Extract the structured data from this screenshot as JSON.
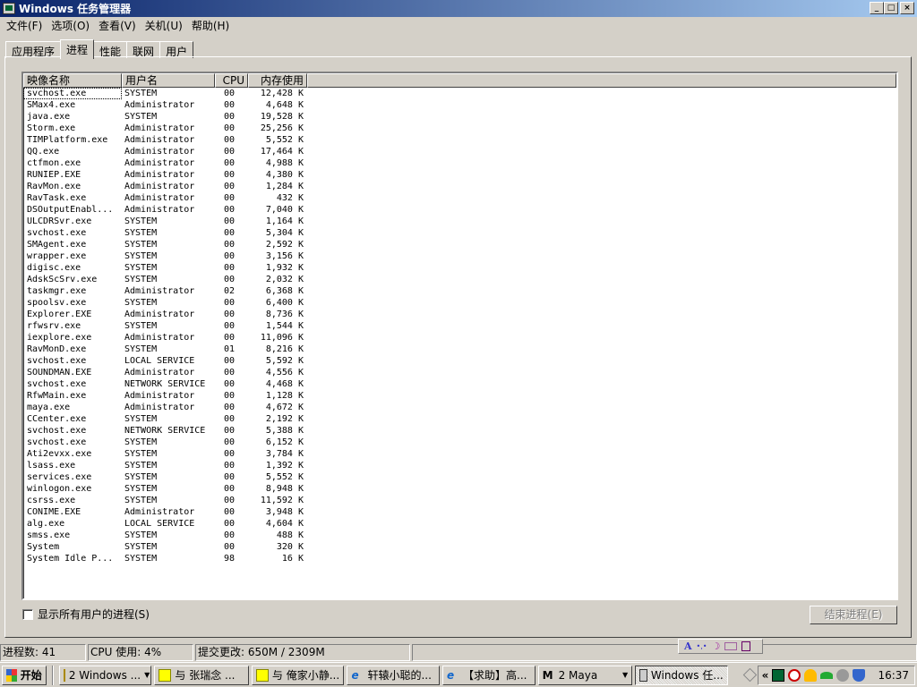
{
  "window": {
    "title": "Windows 任务管理器",
    "min": "_",
    "max": "□",
    "close": "×"
  },
  "menu": [
    "文件(F)",
    "选项(O)",
    "查看(V)",
    "关机(U)",
    "帮助(H)"
  ],
  "tabs": [
    "应用程序",
    "进程",
    "性能",
    "联网",
    "用户"
  ],
  "active_tab": 1,
  "columns": [
    "映像名称",
    "用户名",
    "CPU",
    "内存使用"
  ],
  "processes": [
    [
      "svchost.exe",
      "SYSTEM",
      "00",
      "12,428 K"
    ],
    [
      "SMax4.exe",
      "Administrator",
      "00",
      "4,648 K"
    ],
    [
      "java.exe",
      "SYSTEM",
      "00",
      "19,528 K"
    ],
    [
      "Storm.exe",
      "Administrator",
      "00",
      "25,256 K"
    ],
    [
      "TIMPlatform.exe",
      "Administrator",
      "00",
      "5,552 K"
    ],
    [
      "QQ.exe",
      "Administrator",
      "00",
      "17,464 K"
    ],
    [
      "ctfmon.exe",
      "Administrator",
      "00",
      "4,988 K"
    ],
    [
      "RUNIEP.EXE",
      "Administrator",
      "00",
      "4,380 K"
    ],
    [
      "RavMon.exe",
      "Administrator",
      "00",
      "1,284 K"
    ],
    [
      "RavTask.exe",
      "Administrator",
      "00",
      "432 K"
    ],
    [
      "DSOutputEnabl...",
      "Administrator",
      "00",
      "7,040 K"
    ],
    [
      "ULCDRSvr.exe",
      "SYSTEM",
      "00",
      "1,164 K"
    ],
    [
      "svchost.exe",
      "SYSTEM",
      "00",
      "5,304 K"
    ],
    [
      "SMAgent.exe",
      "SYSTEM",
      "00",
      "2,592 K"
    ],
    [
      "wrapper.exe",
      "SYSTEM",
      "00",
      "3,156 K"
    ],
    [
      "digisc.exe",
      "SYSTEM",
      "00",
      "1,932 K"
    ],
    [
      "AdskScSrv.exe",
      "SYSTEM",
      "00",
      "2,032 K"
    ],
    [
      "taskmgr.exe",
      "Administrator",
      "02",
      "6,368 K"
    ],
    [
      "spoolsv.exe",
      "SYSTEM",
      "00",
      "6,400 K"
    ],
    [
      "Explorer.EXE",
      "Administrator",
      "00",
      "8,736 K"
    ],
    [
      "rfwsrv.exe",
      "SYSTEM",
      "00",
      "1,544 K"
    ],
    [
      "iexplore.exe",
      "Administrator",
      "00",
      "11,096 K"
    ],
    [
      "RavMonD.exe",
      "SYSTEM",
      "01",
      "8,216 K"
    ],
    [
      "svchost.exe",
      "LOCAL SERVICE",
      "00",
      "5,592 K"
    ],
    [
      "SOUNDMAN.EXE",
      "Administrator",
      "00",
      "4,556 K"
    ],
    [
      "svchost.exe",
      "NETWORK SERVICE",
      "00",
      "4,468 K"
    ],
    [
      "RfwMain.exe",
      "Administrator",
      "00",
      "1,128 K"
    ],
    [
      "maya.exe",
      "Administrator",
      "00",
      "4,672 K"
    ],
    [
      "CCenter.exe",
      "SYSTEM",
      "00",
      "2,192 K"
    ],
    [
      "svchost.exe",
      "NETWORK SERVICE",
      "00",
      "5,388 K"
    ],
    [
      "svchost.exe",
      "SYSTEM",
      "00",
      "6,152 K"
    ],
    [
      "Ati2evxx.exe",
      "SYSTEM",
      "00",
      "3,784 K"
    ],
    [
      "lsass.exe",
      "SYSTEM",
      "00",
      "1,392 K"
    ],
    [
      "services.exe",
      "SYSTEM",
      "00",
      "5,552 K"
    ],
    [
      "winlogon.exe",
      "SYSTEM",
      "00",
      "8,948 K"
    ],
    [
      "csrss.exe",
      "SYSTEM",
      "00",
      "11,592 K"
    ],
    [
      "CONIME.EXE",
      "Administrator",
      "00",
      "3,948 K"
    ],
    [
      "alg.exe",
      "LOCAL SERVICE",
      "00",
      "4,604 K"
    ],
    [
      "smss.exe",
      "SYSTEM",
      "00",
      "488 K"
    ],
    [
      "System",
      "SYSTEM",
      "00",
      "320 K"
    ],
    [
      "System Idle P...",
      "SYSTEM",
      "98",
      "16 K"
    ]
  ],
  "show_all_label": "显示所有用户的进程(S)",
  "end_process_label": "结束进程(E)",
  "status": {
    "processes": "进程数: 41",
    "cpu": "CPU 使用: 4%",
    "commit": "提交更改: 650M / 2309M"
  },
  "ime": {
    "a": "A",
    "dots": "•,•",
    "moon": "☽"
  },
  "taskbar": {
    "start": "开始",
    "items": [
      "2 Windows ...",
      "与 张瑞念 ...",
      "与 俺家小静...",
      "轩辕小聪的...",
      "【求助】高...",
      "2 Maya",
      "Windows 任..."
    ],
    "expand": "«",
    "clock": "16:37"
  }
}
